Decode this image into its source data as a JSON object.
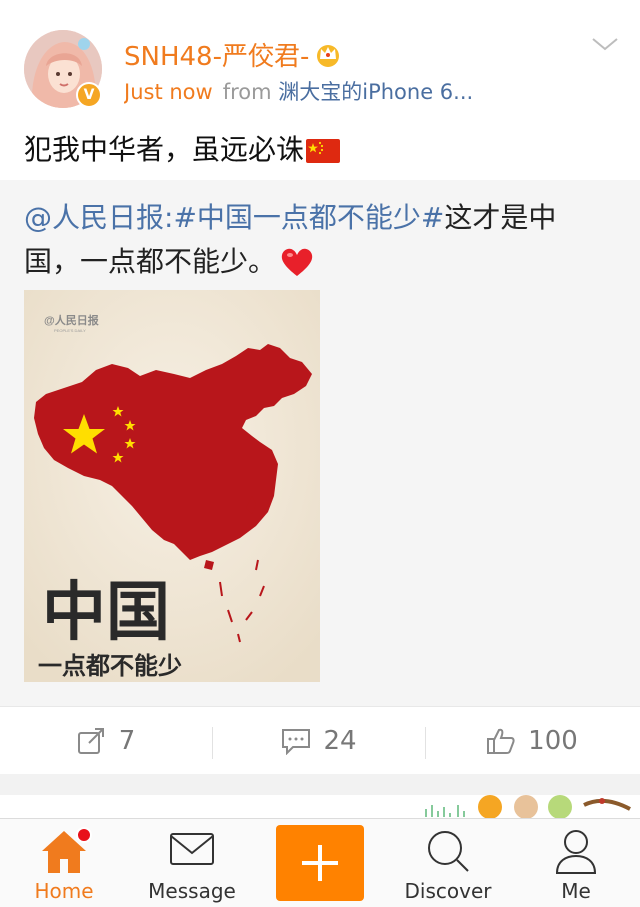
{
  "post": {
    "username": "SNH48-严佼君-",
    "time": "Just now",
    "from_label": "from",
    "device": "渊大宝的iPhone 6...",
    "text": "犯我中华者，虽远必诛"
  },
  "retweet": {
    "mention": "@人民日报",
    "separator": ":",
    "hashtag": "#中国一点都不能少#",
    "text": "这才是中国，一点都不能少。",
    "image": {
      "watermark": "@人民日报",
      "watermark_sub": "PEOPLE'S DAILY",
      "big_text": "中国",
      "small_text": "一点都不能少"
    }
  },
  "actions": {
    "repost_count": "7",
    "comment_count": "24",
    "like_count": "100"
  },
  "tabbar": {
    "home": "Home",
    "message": "Message",
    "discover": "Discover",
    "me": "Me"
  },
  "colors": {
    "accent": "#f07b1e",
    "link": "#4a72a8",
    "map_red": "#b8161b"
  }
}
